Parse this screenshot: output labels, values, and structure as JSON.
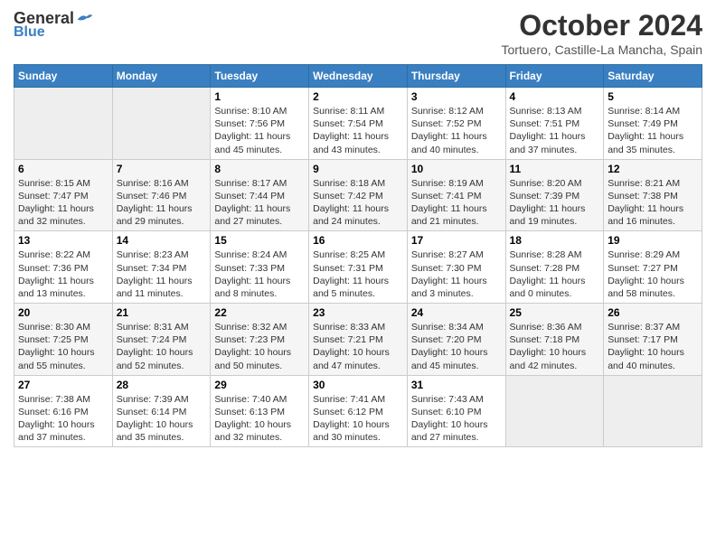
{
  "header": {
    "logo": {
      "general": "General",
      "blue": "Blue"
    },
    "title": "October 2024",
    "location": "Tortuero, Castille-La Mancha, Spain"
  },
  "calendar": {
    "weekdays": [
      "Sunday",
      "Monday",
      "Tuesday",
      "Wednesday",
      "Thursday",
      "Friday",
      "Saturday"
    ],
    "weeks": [
      [
        {
          "day": "",
          "detail": ""
        },
        {
          "day": "",
          "detail": ""
        },
        {
          "day": "1",
          "detail": "Sunrise: 8:10 AM\nSunset: 7:56 PM\nDaylight: 11 hours\nand 45 minutes."
        },
        {
          "day": "2",
          "detail": "Sunrise: 8:11 AM\nSunset: 7:54 PM\nDaylight: 11 hours\nand 43 minutes."
        },
        {
          "day": "3",
          "detail": "Sunrise: 8:12 AM\nSunset: 7:52 PM\nDaylight: 11 hours\nand 40 minutes."
        },
        {
          "day": "4",
          "detail": "Sunrise: 8:13 AM\nSunset: 7:51 PM\nDaylight: 11 hours\nand 37 minutes."
        },
        {
          "day": "5",
          "detail": "Sunrise: 8:14 AM\nSunset: 7:49 PM\nDaylight: 11 hours\nand 35 minutes."
        }
      ],
      [
        {
          "day": "6",
          "detail": "Sunrise: 8:15 AM\nSunset: 7:47 PM\nDaylight: 11 hours\nand 32 minutes."
        },
        {
          "day": "7",
          "detail": "Sunrise: 8:16 AM\nSunset: 7:46 PM\nDaylight: 11 hours\nand 29 minutes."
        },
        {
          "day": "8",
          "detail": "Sunrise: 8:17 AM\nSunset: 7:44 PM\nDaylight: 11 hours\nand 27 minutes."
        },
        {
          "day": "9",
          "detail": "Sunrise: 8:18 AM\nSunset: 7:42 PM\nDaylight: 11 hours\nand 24 minutes."
        },
        {
          "day": "10",
          "detail": "Sunrise: 8:19 AM\nSunset: 7:41 PM\nDaylight: 11 hours\nand 21 minutes."
        },
        {
          "day": "11",
          "detail": "Sunrise: 8:20 AM\nSunset: 7:39 PM\nDaylight: 11 hours\nand 19 minutes."
        },
        {
          "day": "12",
          "detail": "Sunrise: 8:21 AM\nSunset: 7:38 PM\nDaylight: 11 hours\nand 16 minutes."
        }
      ],
      [
        {
          "day": "13",
          "detail": "Sunrise: 8:22 AM\nSunset: 7:36 PM\nDaylight: 11 hours\nand 13 minutes."
        },
        {
          "day": "14",
          "detail": "Sunrise: 8:23 AM\nSunset: 7:34 PM\nDaylight: 11 hours\nand 11 minutes."
        },
        {
          "day": "15",
          "detail": "Sunrise: 8:24 AM\nSunset: 7:33 PM\nDaylight: 11 hours\nand 8 minutes."
        },
        {
          "day": "16",
          "detail": "Sunrise: 8:25 AM\nSunset: 7:31 PM\nDaylight: 11 hours\nand 5 minutes."
        },
        {
          "day": "17",
          "detail": "Sunrise: 8:27 AM\nSunset: 7:30 PM\nDaylight: 11 hours\nand 3 minutes."
        },
        {
          "day": "18",
          "detail": "Sunrise: 8:28 AM\nSunset: 7:28 PM\nDaylight: 11 hours\nand 0 minutes."
        },
        {
          "day": "19",
          "detail": "Sunrise: 8:29 AM\nSunset: 7:27 PM\nDaylight: 10 hours\nand 58 minutes."
        }
      ],
      [
        {
          "day": "20",
          "detail": "Sunrise: 8:30 AM\nSunset: 7:25 PM\nDaylight: 10 hours\nand 55 minutes."
        },
        {
          "day": "21",
          "detail": "Sunrise: 8:31 AM\nSunset: 7:24 PM\nDaylight: 10 hours\nand 52 minutes."
        },
        {
          "day": "22",
          "detail": "Sunrise: 8:32 AM\nSunset: 7:23 PM\nDaylight: 10 hours\nand 50 minutes."
        },
        {
          "day": "23",
          "detail": "Sunrise: 8:33 AM\nSunset: 7:21 PM\nDaylight: 10 hours\nand 47 minutes."
        },
        {
          "day": "24",
          "detail": "Sunrise: 8:34 AM\nSunset: 7:20 PM\nDaylight: 10 hours\nand 45 minutes."
        },
        {
          "day": "25",
          "detail": "Sunrise: 8:36 AM\nSunset: 7:18 PM\nDaylight: 10 hours\nand 42 minutes."
        },
        {
          "day": "26",
          "detail": "Sunrise: 8:37 AM\nSunset: 7:17 PM\nDaylight: 10 hours\nand 40 minutes."
        }
      ],
      [
        {
          "day": "27",
          "detail": "Sunrise: 7:38 AM\nSunset: 6:16 PM\nDaylight: 10 hours\nand 37 minutes."
        },
        {
          "day": "28",
          "detail": "Sunrise: 7:39 AM\nSunset: 6:14 PM\nDaylight: 10 hours\nand 35 minutes."
        },
        {
          "day": "29",
          "detail": "Sunrise: 7:40 AM\nSunset: 6:13 PM\nDaylight: 10 hours\nand 32 minutes."
        },
        {
          "day": "30",
          "detail": "Sunrise: 7:41 AM\nSunset: 6:12 PM\nDaylight: 10 hours\nand 30 minutes."
        },
        {
          "day": "31",
          "detail": "Sunrise: 7:43 AM\nSunset: 6:10 PM\nDaylight: 10 hours\nand 27 minutes."
        },
        {
          "day": "",
          "detail": ""
        },
        {
          "day": "",
          "detail": ""
        }
      ]
    ]
  }
}
